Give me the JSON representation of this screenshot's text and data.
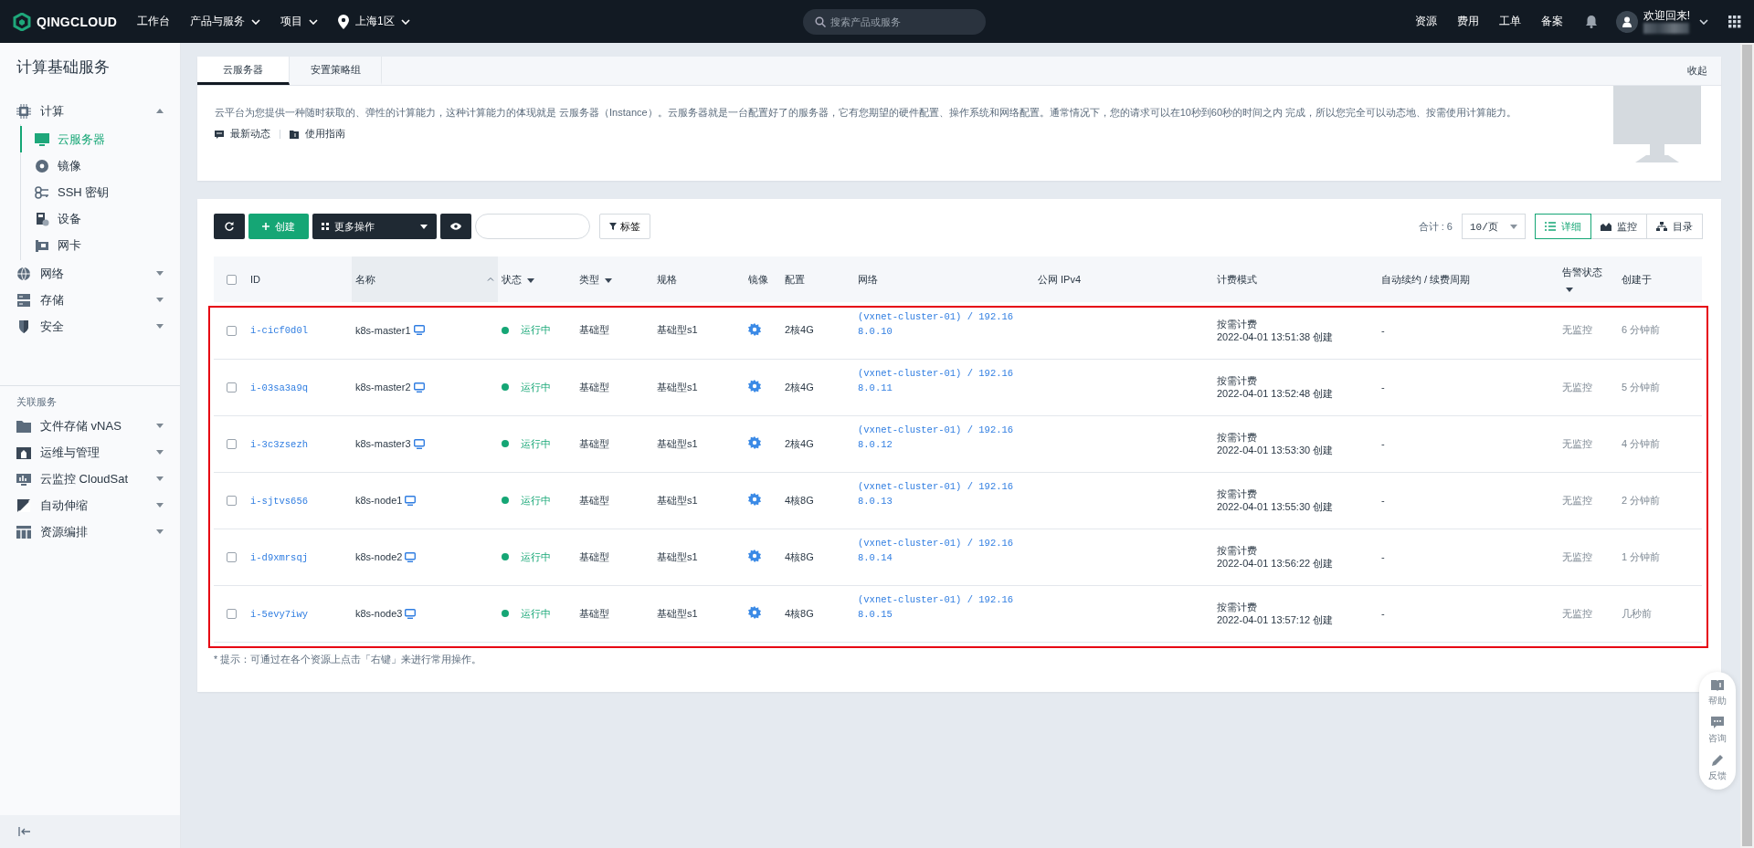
{
  "topbar": {
    "logo": "QINGCLOUD",
    "nav": [
      {
        "label": "工作台",
        "kind": "plain"
      },
      {
        "label": "产品与服务",
        "kind": "dropdown"
      },
      {
        "label": "项目",
        "kind": "dropdown"
      },
      {
        "label": "上海1区",
        "kind": "zone"
      }
    ],
    "search": {
      "placeholder": "搜索产品或服务"
    },
    "links": [
      "资源",
      "费用",
      "工单",
      "备案"
    ],
    "user": {
      "greeting": "欢迎回来!"
    }
  },
  "sidebar": {
    "title": "计算基础服务",
    "groups": [
      {
        "label": "计算",
        "expanded": true,
        "children": [
          {
            "label": "云服务器",
            "selected": true
          },
          {
            "label": "镜像",
            "selected": false
          },
          {
            "label": "SSH 密钥",
            "selected": false
          },
          {
            "label": "设备",
            "selected": false
          },
          {
            "label": "网卡",
            "selected": false
          }
        ]
      },
      {
        "label": "网络",
        "expanded": false
      },
      {
        "label": "存储",
        "expanded": false
      },
      {
        "label": "安全",
        "expanded": false
      }
    ],
    "related_title": "关联服务",
    "related": [
      {
        "label": "文件存储 vNAS",
        "expanded": false
      },
      {
        "label": "运维与管理",
        "expanded": false
      },
      {
        "label": "云监控 CloudSat",
        "expanded": false
      },
      {
        "label": "自动伸缩",
        "expanded": false
      },
      {
        "label": "资源编排",
        "expanded": false
      }
    ]
  },
  "intro": {
    "tabs": [
      {
        "label": "云服务器",
        "selected": true
      },
      {
        "label": "安置策略组",
        "selected": false
      }
    ],
    "collapse": "收起",
    "description": "云平台为您提供一种随时获取的、弹性的计算能力，这种计算能力的体现就是 云服务器（Instance）。云服务器就是一台配置好了的服务器，它有您期望的硬件配置、操作系统和网络配置。通常情况下，您的请求可以在10秒到60秒的时间之内 完成，所以您完全可以动态地、按需使用计算能力。",
    "links": [
      "最新动态",
      "使用指南"
    ]
  },
  "toolbar": {
    "create": "创建",
    "more": "更多操作",
    "tag": "标签",
    "total": "合计 : 6",
    "page_size": "10/页",
    "views": [
      {
        "label": "详细",
        "selected": true
      },
      {
        "label": "监控",
        "selected": false
      },
      {
        "label": "目录",
        "selected": false
      }
    ]
  },
  "table": {
    "highlighted": true,
    "select_all": false,
    "columns": [
      {
        "label": "ID",
        "kind": "plain"
      },
      {
        "label": "名称",
        "kind": "sort"
      },
      {
        "label": "状态",
        "kind": "filter"
      },
      {
        "label": "类型",
        "kind": "filter"
      },
      {
        "label": "规格",
        "kind": "plain"
      },
      {
        "label": "镜像",
        "kind": "plain"
      },
      {
        "label": "配置",
        "kind": "plain"
      },
      {
        "label": "网络",
        "kind": "plain"
      },
      {
        "label": "公网 IPv4",
        "kind": "plain"
      },
      {
        "label": "计费模式",
        "kind": "plain"
      },
      {
        "label": "自动续约 / 续费周期",
        "kind": "plain"
      },
      {
        "label": "告警状态",
        "kind": "filter-below"
      },
      {
        "label": "创建于",
        "kind": "plain"
      }
    ],
    "rows": [
      {
        "selected": false,
        "id": "i-cicf0d0l",
        "name": "k8s-master1",
        "status": "运行中",
        "type": "基础型",
        "spec": "基础型s1",
        "config": "2核4G",
        "network": "(vxnet-cluster-01) / 192.168.0.10",
        "billing": "按需计费",
        "billing_time": "2022-04-01 13:51:38 创建",
        "renew": "-",
        "alarm": "无监控",
        "created": "6 分钟前"
      },
      {
        "selected": false,
        "id": "i-03sa3a9q",
        "name": "k8s-master2",
        "status": "运行中",
        "type": "基础型",
        "spec": "基础型s1",
        "config": "2核4G",
        "network": "(vxnet-cluster-01) / 192.168.0.11",
        "billing": "按需计费",
        "billing_time": "2022-04-01 13:52:48 创建",
        "renew": "-",
        "alarm": "无监控",
        "created": "5 分钟前"
      },
      {
        "selected": false,
        "id": "i-3c3zsezh",
        "name": "k8s-master3",
        "status": "运行中",
        "type": "基础型",
        "spec": "基础型s1",
        "config": "2核4G",
        "network": "(vxnet-cluster-01) / 192.168.0.12",
        "billing": "按需计费",
        "billing_time": "2022-04-01 13:53:30 创建",
        "renew": "-",
        "alarm": "无监控",
        "created": "4 分钟前"
      },
      {
        "selected": false,
        "id": "i-sjtvs656",
        "name": "k8s-node1",
        "status": "运行中",
        "type": "基础型",
        "spec": "基础型s1",
        "config": "4核8G",
        "network": "(vxnet-cluster-01) / 192.168.0.13",
        "billing": "按需计费",
        "billing_time": "2022-04-01 13:55:30 创建",
        "renew": "-",
        "alarm": "无监控",
        "created": "2 分钟前"
      },
      {
        "selected": false,
        "id": "i-d9xmrsqj",
        "name": "k8s-node2",
        "status": "运行中",
        "type": "基础型",
        "spec": "基础型s1",
        "config": "4核8G",
        "network": "(vxnet-cluster-01) / 192.168.0.14",
        "billing": "按需计费",
        "billing_time": "2022-04-01 13:56:22 创建",
        "renew": "-",
        "alarm": "无监控",
        "created": "1 分钟前"
      },
      {
        "selected": false,
        "id": "i-5evy7iwy",
        "name": "k8s-node3",
        "status": "运行中",
        "type": "基础型",
        "spec": "基础型s1",
        "config": "4核8G",
        "network": "(vxnet-cluster-01) / 192.168.0.15",
        "billing": "按需计费",
        "billing_time": "2022-04-01 13:57:12 创建",
        "renew": "-",
        "alarm": "无监控",
        "created": "几秒前"
      }
    ]
  },
  "footnote": "* 提示：可通过在各个资源上点击「右键」来进行常用操作。",
  "help": [
    "帮助",
    "咨询",
    "反馈"
  ]
}
